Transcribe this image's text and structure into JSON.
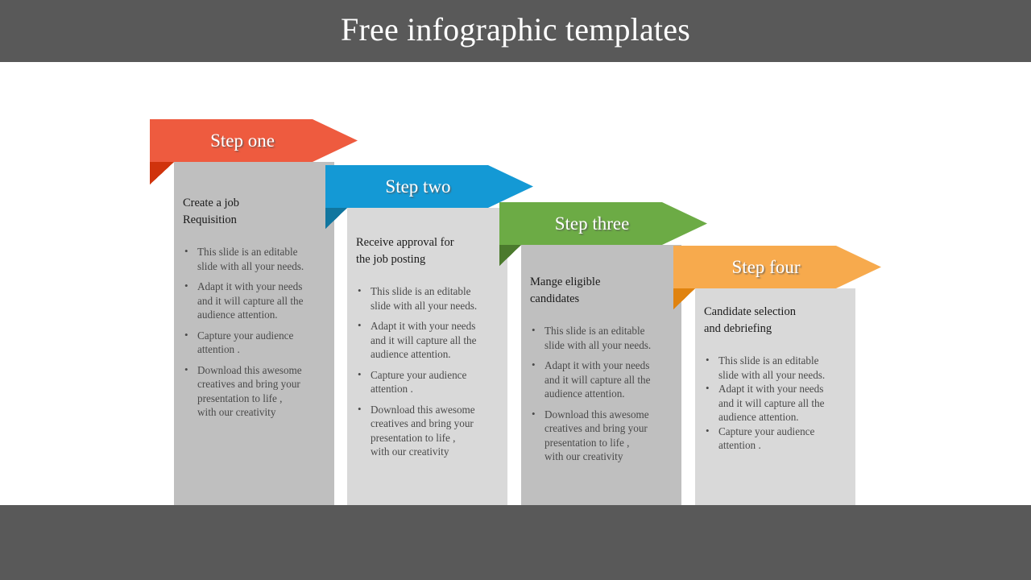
{
  "header": {
    "title": "Free infographic templates",
    "bar_color": "#595959",
    "title_color": "#ffffff"
  },
  "footer": {
    "bar_color": "#595959"
  },
  "slide": {
    "background": "#ffffff",
    "panel_colors": [
      "#BFBFBF",
      "#D9D9D9",
      "#BFBFBF",
      "#D9D9D9"
    ]
  },
  "steps": [
    {
      "label": "Step one",
      "arrow_color": "#EE5B3F",
      "fold_color": "#D0330C",
      "panel_color": "#BFBFBF",
      "heading": "Create a job\nRequisition",
      "bullets": [
        "This slide is an editable\nslide with all your needs.",
        "Adapt it with your needs\nand it will capture all the\naudience attention.",
        "Capture your audience\nattention .",
        "Download this awesome\ncreatives and bring your\npresentation to life ,\nwith our creativity"
      ]
    },
    {
      "label": "Step two",
      "arrow_color": "#1499D5",
      "fold_color": "#11769F",
      "panel_color": "#D9D9D9",
      "heading": "Receive approval for\nthe job posting",
      "bullets": [
        "This slide is an editable\nslide with all your needs.",
        "Adapt it with your needs\nand it will capture all the\naudience attention.",
        "Capture your audience\nattention .",
        "Download this awesome\ncreatives and bring your\npresentation to life ,\nwith our creativity"
      ]
    },
    {
      "label": "Step three",
      "arrow_color": "#6CAB45",
      "fold_color": "#4B7A2D",
      "panel_color": "#BFBFBF",
      "heading": "Mange eligible\ncandidates",
      "bullets": [
        "This slide is an editable\nslide with all your needs.",
        "Adapt it with your needs\nand it will capture all the\naudience attention.",
        "Download this awesome\ncreatives and bring your\npresentation to life ,\nwith our creativity"
      ]
    },
    {
      "label": "Step four",
      "arrow_color": "#F7AA4D",
      "fold_color": "#E0830F",
      "panel_color": "#D9D9D9",
      "heading": "Candidate selection\nand debriefing",
      "bullets": [
        "This slide is an editable\nslide with all your needs.",
        "Adapt it with your needs\nand it will capture all the\naudience attention.",
        "Capture your audience\nattention ."
      ]
    }
  ]
}
